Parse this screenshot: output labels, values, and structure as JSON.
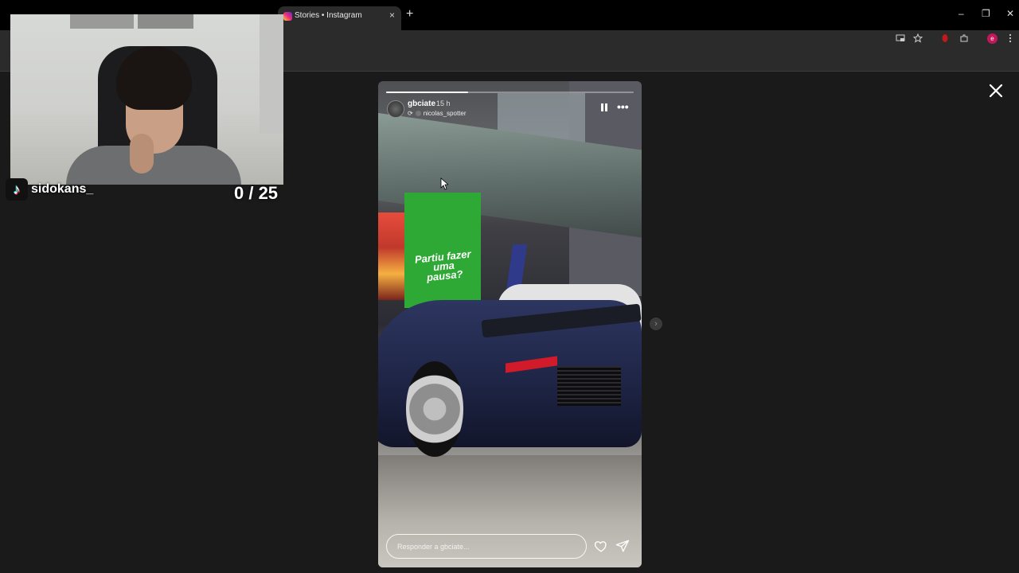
{
  "browser": {
    "active_tab_title": "Stories • Instagram",
    "tab_close": "×",
    "new_tab": "+",
    "window_controls": [
      "–",
      "❐",
      "✕"
    ],
    "extension_avatar_letter": "e"
  },
  "stream_overlay": {
    "tiktok_handle": "sidokans_",
    "counter": "0 / 25"
  },
  "story": {
    "username": "gbciate",
    "time_ago": "15 h",
    "reposted_from": "nicolas_spotter",
    "sign_text": "Partiu fazer uma pausa?",
    "progress": 0.33,
    "reply_placeholder": "Responder a gbciate...",
    "more_glyph": "•••",
    "next_glyph": "›"
  },
  "colors": {
    "page_bg": "#1a1a1a",
    "chrome_bg": "#2b2b2b",
    "tabbar_bg": "#000000",
    "instagram_gradient": [
      "#f9ce34",
      "#ee2a7b",
      "#6228d7"
    ],
    "sign_green": "#2fa935"
  },
  "icons": [
    "instagram-favicon",
    "cast-icon",
    "star-icon",
    "extensions-icon",
    "menu-icon",
    "pause-icon",
    "more-icon",
    "heart-icon",
    "send-icon",
    "close-icon",
    "chevron-right-icon",
    "tiktok-logo"
  ]
}
